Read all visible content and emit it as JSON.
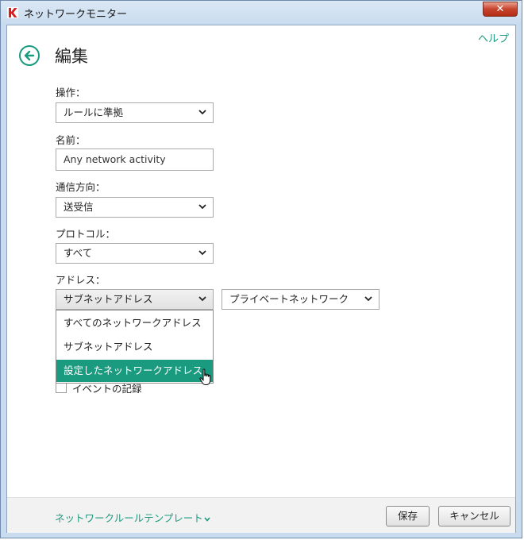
{
  "window": {
    "title": "ネットワークモニター",
    "close_glyph": "✕"
  },
  "header": {
    "help": "ヘルプ",
    "title": "編集"
  },
  "form": {
    "operation": {
      "label": "操作：",
      "value": "ルールに準拠"
    },
    "name": {
      "label": "名前：",
      "value": "Any network activity"
    },
    "direction": {
      "label": "通信方向：",
      "value": "送受信"
    },
    "protocol": {
      "label": "プロトコル：",
      "value": "すべて"
    },
    "address": {
      "label": "アドレス：",
      "value": "サブネットアドレス",
      "subnet_value": "プライベートネットワーク",
      "options": [
        "すべてのネットワークアドレス",
        "サブネットアドレス",
        "設定したネットワークアドレス"
      ],
      "highlighted_index": 2
    },
    "log_events": {
      "label": "イベントの記録",
      "checked": false
    }
  },
  "footer": {
    "template_link": "ネットワークルールテンプレート",
    "save": "保存",
    "cancel": "キャンセル"
  },
  "colors": {
    "accent": "#1a9a7f"
  }
}
